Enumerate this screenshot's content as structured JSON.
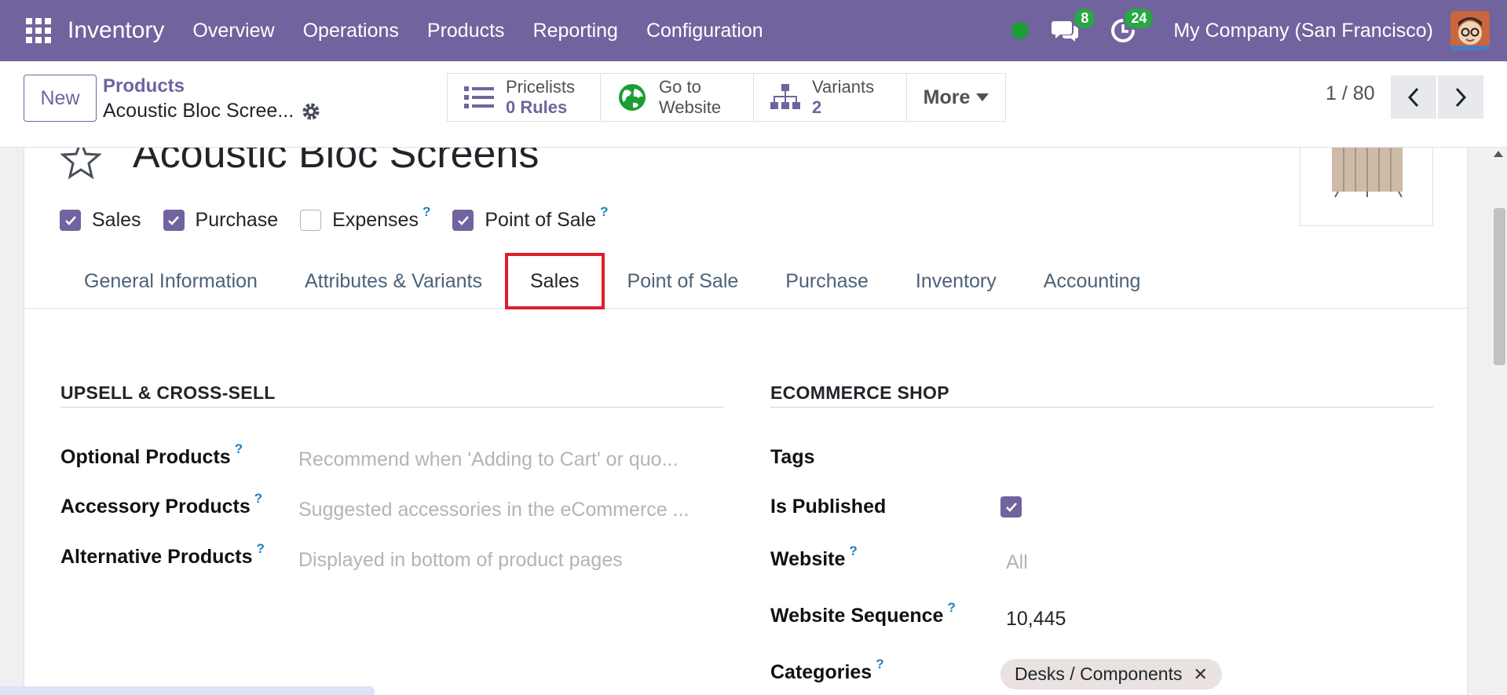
{
  "navbar": {
    "app_name": "Inventory",
    "menu": [
      "Overview",
      "Operations",
      "Products",
      "Reporting",
      "Configuration"
    ],
    "messages_count": "8",
    "activities_count": "24",
    "company": "My Company (San Francisco)",
    "color": "#71639e"
  },
  "control": {
    "new_label": "New",
    "breadcrumb_parent": "Products",
    "breadcrumb_current": "Acoustic Bloc Scree...",
    "smart_buttons": {
      "pricelists": {
        "label": "Pricelists",
        "value": "0  Rules"
      },
      "website": {
        "line1": "Go to",
        "line2": "Website"
      },
      "variants": {
        "label": "Variants",
        "value": "2"
      }
    },
    "more_label": "More",
    "pager": "1 / 80"
  },
  "form": {
    "title": "Acoustic Bloc Screens",
    "checkboxes": [
      {
        "label": "Sales",
        "checked": true
      },
      {
        "label": "Purchase",
        "checked": true
      },
      {
        "label": "Expenses",
        "checked": false,
        "help": "?"
      },
      {
        "label": "Point of Sale",
        "checked": true,
        "help": "?"
      }
    ],
    "tabs": [
      "General Information",
      "Attributes & Variants",
      "Sales",
      "Point of Sale",
      "Purchase",
      "Inventory",
      "Accounting"
    ],
    "active_tab": "Sales",
    "upsell": {
      "title": "UPSELL & CROSS-SELL",
      "optional_label": "Optional Products",
      "optional_placeholder": "Recommend when 'Adding to Cart' or quo...",
      "accessory_label": "Accessory Products",
      "accessory_placeholder": "Suggested accessories in the eCommerce ...",
      "alternative_label": "Alternative Products",
      "alternative_placeholder": "Displayed in bottom of product pages"
    },
    "ecommerce": {
      "title": "ECOMMERCE SHOP",
      "tags_label": "Tags",
      "published_label": "Is Published",
      "published": true,
      "website_label": "Website",
      "website_value": "All",
      "sequence_label": "Website Sequence",
      "sequence_value": "10,445",
      "categories_label": "Categories",
      "category_tag": "Desks / Components"
    },
    "help_mark": "?"
  }
}
